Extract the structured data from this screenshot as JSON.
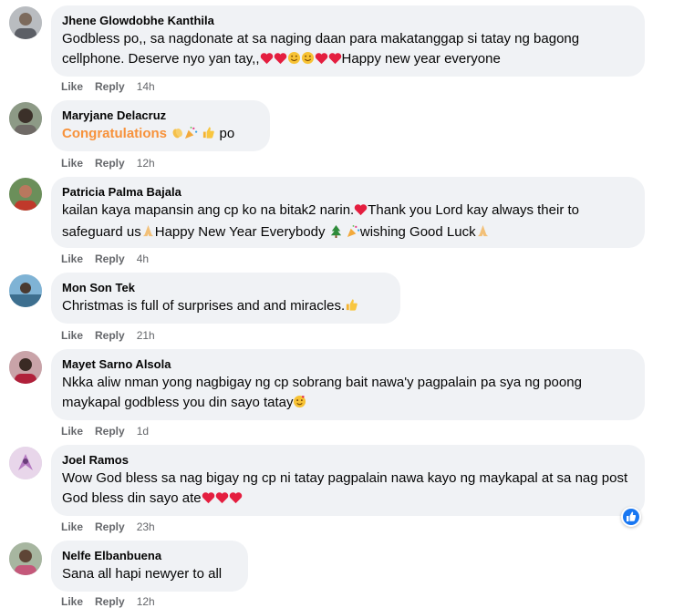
{
  "comments": [
    {
      "author": "Jhene Glowdobhe Kanthila",
      "text": "Godbless po,, sa nagdonate at sa naging daan para makatanggap si tatay ng bagong cellphone. Deserve nyo yan tay,,",
      "text_after": "Happy new year everyone",
      "like": "Like",
      "reply": "Reply",
      "time": "14h"
    },
    {
      "author": "Maryjane Delacruz",
      "text": "Congratulations",
      "text_after": "po",
      "like": "Like",
      "reply": "Reply",
      "time": "12h"
    },
    {
      "author": "Patricia Palma Bajala",
      "text": "kailan kaya mapansin ang cp ko na bitak2 narin.",
      "text_mid": "Thank you Lord kay always their to safeguard us",
      "text_mid2": "Happy New Year Everybody",
      "text_after": "wishing Good Luck",
      "like": "Like",
      "reply": "Reply",
      "time": "4h"
    },
    {
      "author": "Mon Son Tek",
      "text": "Christmas is full of surprises and and miracles.",
      "like": "Like",
      "reply": "Reply",
      "time": "21h"
    },
    {
      "author": "Mayet Sarno Alsola",
      "text": "Nkka aliw nman yong nagbigay ng cp sobrang bait nawa'y pagpalain pa sya ng poong maykapal godbless you din sayo tatay",
      "like": "Like",
      "reply": "Reply",
      "time": "1d"
    },
    {
      "author": "Joel Ramos",
      "text": "Wow God bless sa nag bigay ng cp ni tatay pagpalain nawa kayo ng maykapal at sa nag post God bless din sayo ate",
      "like": "Like",
      "reply": "Reply",
      "time": "23h"
    },
    {
      "author": "Nelfe Elbanbuena",
      "text": "Sana all hapi newyer to all",
      "like": "Like",
      "reply": "Reply",
      "time": "12h"
    }
  ],
  "colors": {
    "bubble": "#f0f2f5",
    "muted": "#65676b",
    "accent": "#f7923b",
    "like_blue": "#1877f2",
    "heart": "#e41e3f"
  },
  "icons": [
    "heart-emoji",
    "smiling-emoji",
    "clap-emoji",
    "party-popper-emoji",
    "thumbs-up-emoji",
    "praying-hands-emoji",
    "tree-emoji",
    "heart-face-emoji",
    "like-reaction-icon"
  ]
}
